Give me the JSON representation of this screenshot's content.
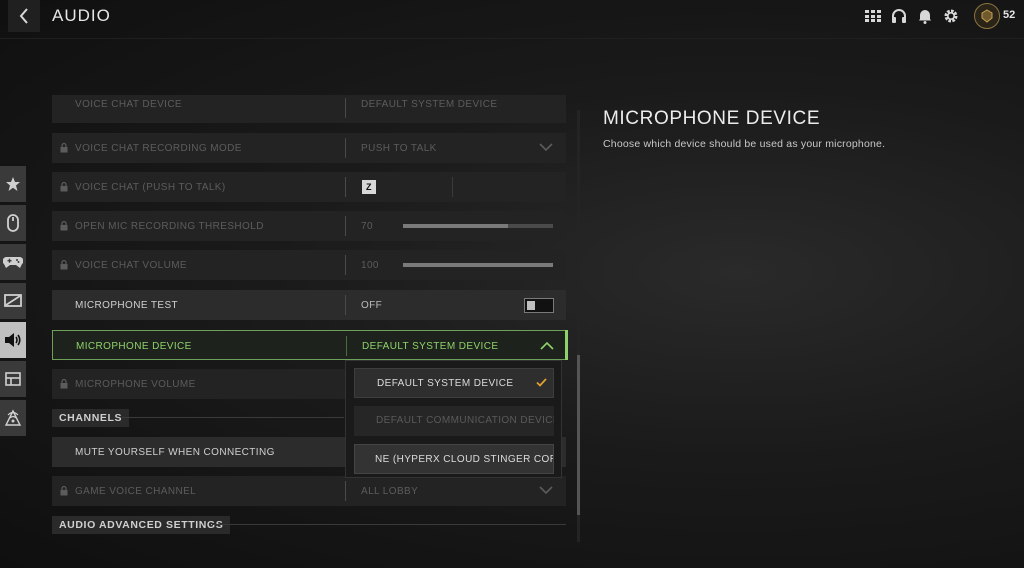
{
  "header": {
    "title": "AUDIO",
    "level": "52"
  },
  "topbar_icons": [
    "grid-icon",
    "headset-icon",
    "bell-icon",
    "gear-icon"
  ],
  "sidebar": {
    "tabs": [
      {
        "name": "favorites",
        "icon": "star-icon",
        "active": false
      },
      {
        "name": "mouse",
        "icon": "mouse-icon",
        "active": false
      },
      {
        "name": "controller",
        "icon": "controller-icon",
        "active": false
      },
      {
        "name": "graphics",
        "icon": "display-icon",
        "active": false
      },
      {
        "name": "audio",
        "icon": "speaker-icon",
        "active": true
      },
      {
        "name": "interface",
        "icon": "layout-icon",
        "active": false
      },
      {
        "name": "network",
        "icon": "network-icon",
        "active": false
      }
    ]
  },
  "settings": {
    "voice_chat_device": {
      "label": "VOICE CHAT DEVICE",
      "value": "DEFAULT SYSTEM DEVICE"
    },
    "recording_mode": {
      "label": "VOICE CHAT RECORDING MODE",
      "value": "PUSH TO TALK"
    },
    "push_to_talk": {
      "label": "VOICE CHAT (PUSH TO TALK)",
      "key": "Z"
    },
    "threshold": {
      "label": "OPEN MIC RECORDING THRESHOLD",
      "value": "70",
      "fill": 0.7
    },
    "voice_volume": {
      "label": "VOICE CHAT VOLUME",
      "value": "100",
      "fill": 1.0
    },
    "mic_test": {
      "label": "MICROPHONE TEST",
      "value": "OFF"
    },
    "mic_device": {
      "label": "MICROPHONE DEVICE",
      "value": "DEFAULT SYSTEM DEVICE"
    },
    "mic_volume": {
      "label": "MICROPHONE VOLUME"
    }
  },
  "channels": {
    "heading": "CHANNELS",
    "mute_on_connect": {
      "label": "MUTE YOURSELF WHEN CONNECTING"
    },
    "game_voice": {
      "label": "GAME VOICE CHANNEL",
      "value": "ALL LOBBY"
    }
  },
  "advanced": {
    "heading": "AUDIO ADVANCED SETTINGS"
  },
  "dropdown": {
    "options": [
      {
        "label": "DEFAULT SYSTEM DEVICE",
        "state": "selected"
      },
      {
        "label": "DEFAULT COMMUNICATION DEVICE",
        "state": "disabled"
      },
      {
        "label": "NE (HYPERX CLOUD STINGER CORE",
        "state": "normal"
      }
    ]
  },
  "detail": {
    "title": "MICROPHONE DEVICE",
    "description": "Choose which device should be used as your microphone."
  },
  "colors": {
    "accent_green": "#8fd16b",
    "check_orange": "#e0a030"
  }
}
